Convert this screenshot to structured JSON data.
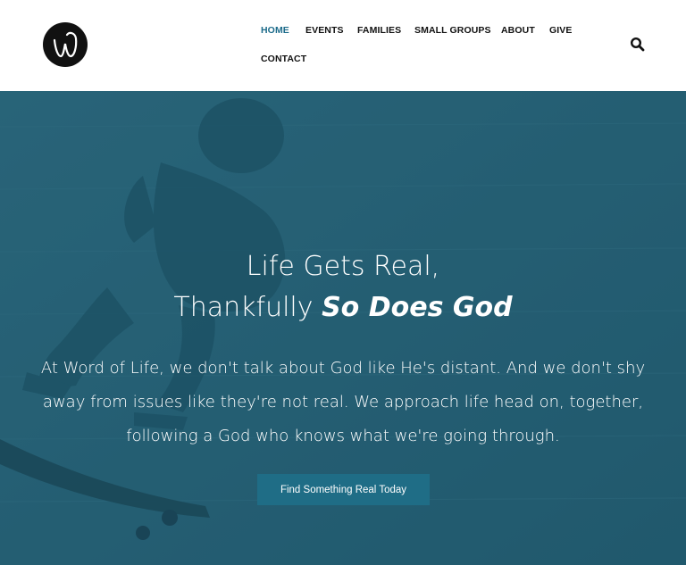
{
  "brand": {
    "logo_icon": "word-of-life-w-logo"
  },
  "nav": {
    "items": [
      {
        "label": "HOME",
        "active": true
      },
      {
        "label": "EVENTS",
        "active": false
      },
      {
        "label": "FAMILIES",
        "active": false
      },
      {
        "label": "SMALL GROUPS",
        "active": false
      },
      {
        "label": "ABOUT",
        "active": false
      },
      {
        "label": "GIVE",
        "active": false
      },
      {
        "label": "CONTACT",
        "active": false
      }
    ],
    "search_icon": "search-icon",
    "active_color": "#1c6b8a"
  },
  "hero": {
    "headline_line1": "Life Gets Real,",
    "headline_line2_prefix": "Thankfully ",
    "headline_line2_bold": "So Does God",
    "tagline": "At Word of Life, we don't talk about God like He's distant. And we don't shy away from issues like they're not real. We approach life head on, together, following a God who knows what we're going through.",
    "cta_label": "Find Something Real Today",
    "background_color": "#2b6479",
    "cta_color": "#1f6d86"
  }
}
